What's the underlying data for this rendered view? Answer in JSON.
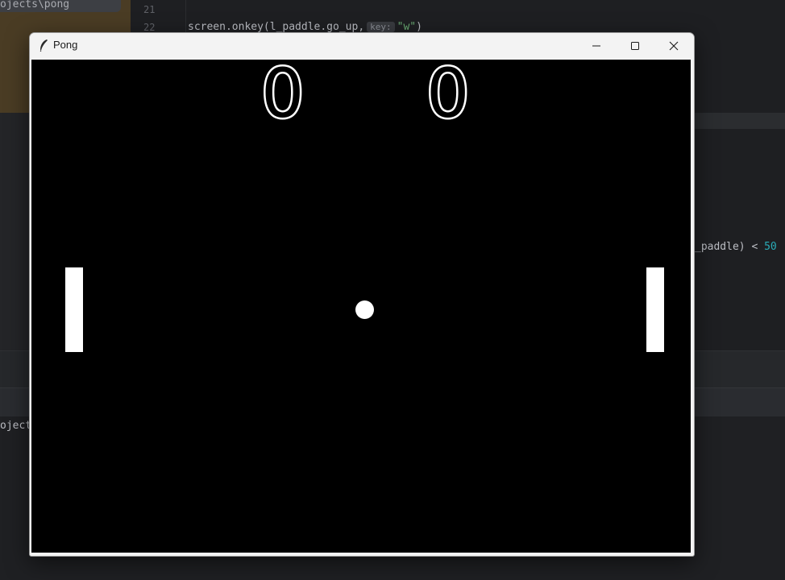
{
  "ide": {
    "path_text": "ojects\\pong",
    "line_numbers": [
      "21",
      "22"
    ],
    "code_line": {
      "prefix": "screen.onkey(l_paddle.go_up,",
      "hint": "key:",
      "string": "\"w\"",
      "suffix": ")"
    },
    "code_right": {
      "text": "_paddle) < ",
      "number": "50"
    },
    "terminal_text": "oject"
  },
  "window": {
    "title": "Pong",
    "icon": "feather-icon",
    "controls": [
      "minimize-icon",
      "maximize-icon",
      "close-icon"
    ]
  },
  "game": {
    "score_left": "0",
    "score_right": "0",
    "background_color": "#000000",
    "foreground_color": "#ffffff"
  }
}
